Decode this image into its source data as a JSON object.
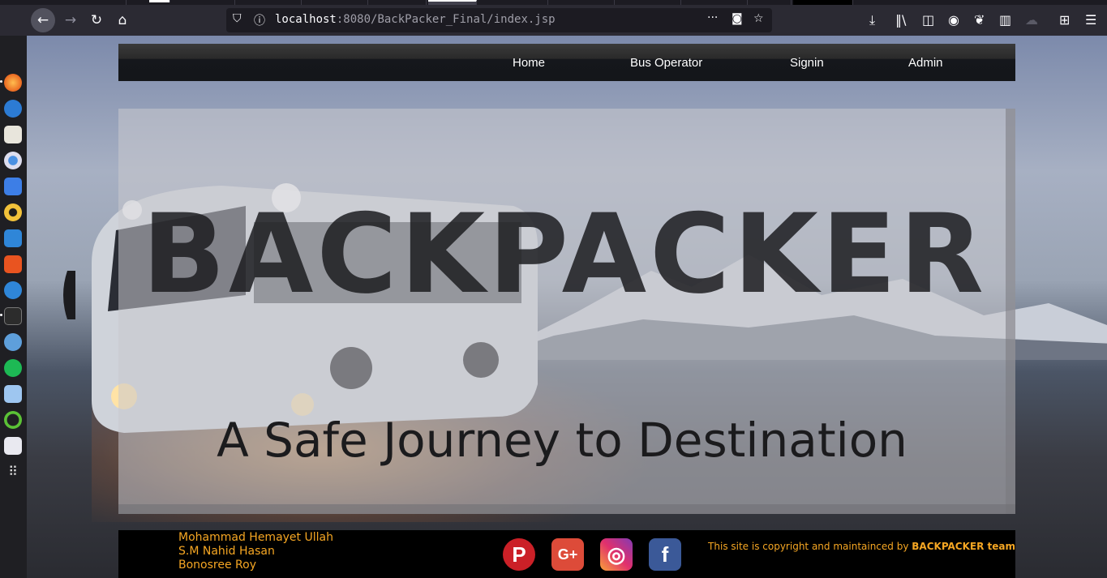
{
  "browser": {
    "url_host": "localhost",
    "url_port": ":8080",
    "url_path": "/BackPacker_Final/index.jsp",
    "more_icon": "···"
  },
  "nav": {
    "items": [
      {
        "label": "Home"
      },
      {
        "label": "Bus Operator"
      },
      {
        "label": "Signin"
      },
      {
        "label": "Admin"
      }
    ]
  },
  "hero": {
    "title": "BACKPACKER",
    "tagline": "A Safe Journey to Destination"
  },
  "footer": {
    "names": [
      "Mohammad Hemayet Ullah",
      "S.M Nahid Hasan",
      "Bonosree Roy"
    ],
    "copyright_prefix": "This site is copyright and maintainced by",
    "copyright_team": "BACKPACKER team",
    "social": [
      {
        "icon": "pinterest-icon",
        "glyph": "P",
        "color": "#cb2027"
      },
      {
        "icon": "google-plus-icon",
        "glyph": "G+",
        "color": "#dd4b39"
      },
      {
        "icon": "instagram-icon",
        "glyph": "◎",
        "color": "#c13584"
      },
      {
        "icon": "facebook-icon",
        "glyph": "f",
        "color": "#3b5998"
      }
    ]
  },
  "colors": {
    "accent": "#f5a623",
    "navbar": "#15171c",
    "footer": "#000000"
  }
}
